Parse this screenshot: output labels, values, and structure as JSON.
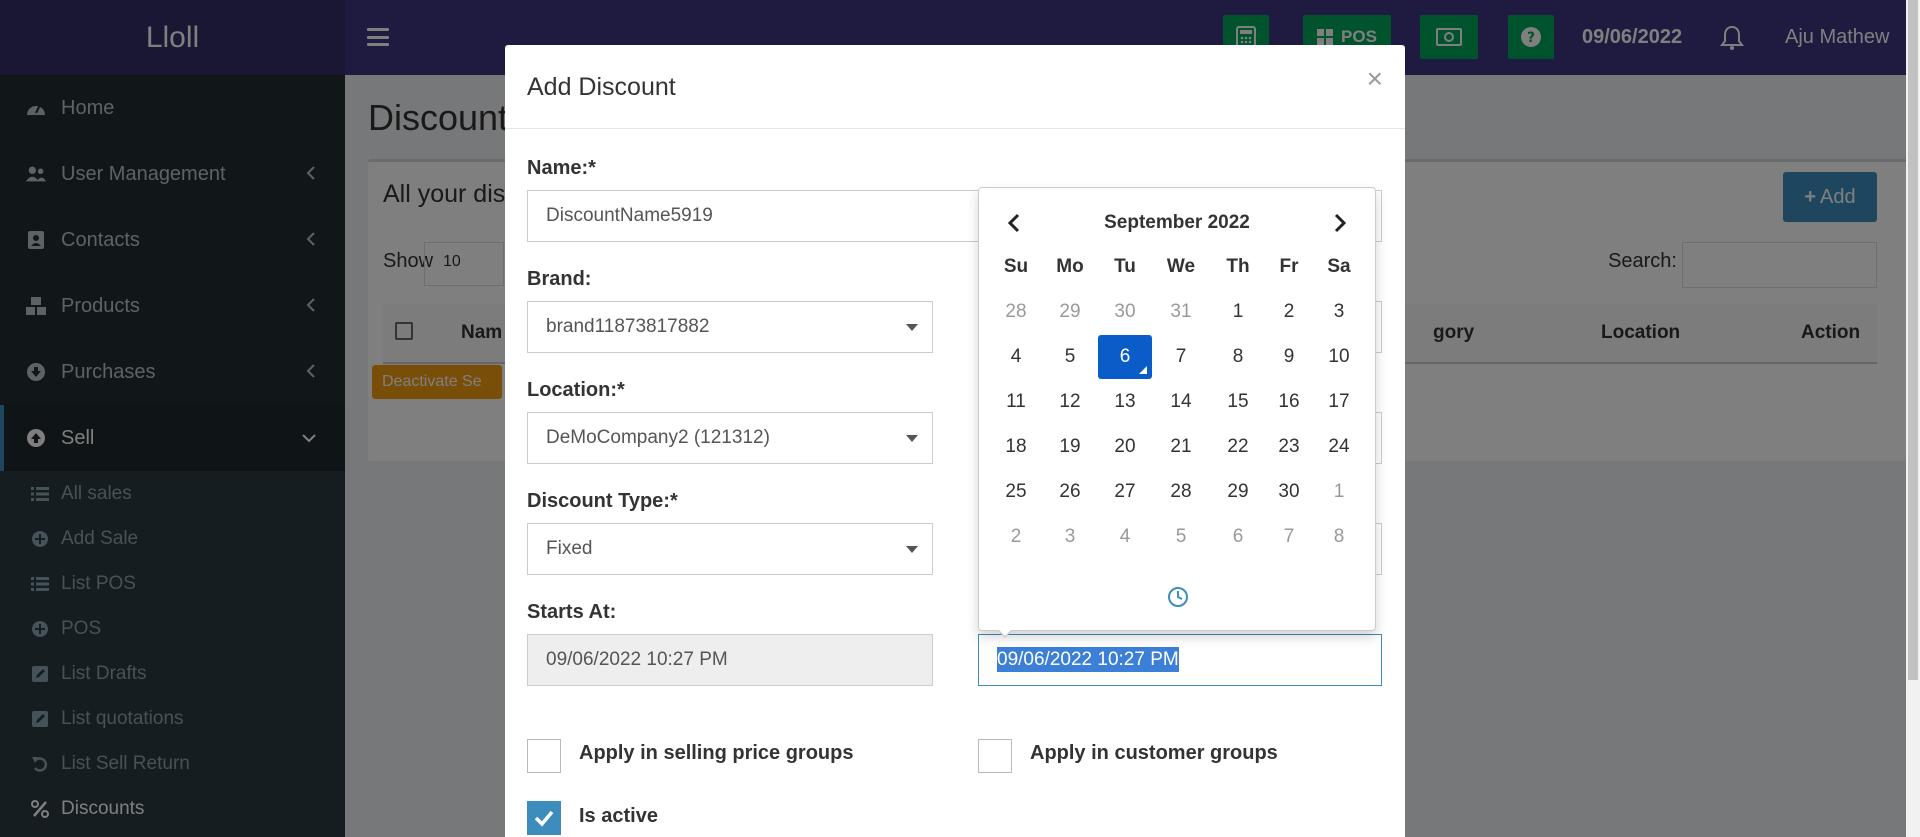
{
  "app": {
    "logo": "Lloll"
  },
  "topbar": {
    "pos_label": "POS",
    "date": "09/06/2022",
    "user": "Aju Mathew"
  },
  "sidebar": {
    "items": [
      {
        "label": "Home",
        "icon": "dashboard-icon"
      },
      {
        "label": "User Management",
        "icon": "users-icon"
      },
      {
        "label": "Contacts",
        "icon": "address-book-icon"
      },
      {
        "label": "Products",
        "icon": "cubes-icon"
      },
      {
        "label": "Purchases",
        "icon": "arrow-circle-down-icon"
      },
      {
        "label": "Sell",
        "icon": "arrow-circle-up-icon"
      }
    ],
    "sub_items": [
      {
        "label": "All sales",
        "icon": "list-icon"
      },
      {
        "label": "Add Sale",
        "icon": "plus-circle-icon"
      },
      {
        "label": "List POS",
        "icon": "list-icon"
      },
      {
        "label": "POS",
        "icon": "plus-circle-icon"
      },
      {
        "label": "List Drafts",
        "icon": "edit-icon"
      },
      {
        "label": "List quotations",
        "icon": "edit-icon"
      },
      {
        "label": "List Sell Return",
        "icon": "undo-icon"
      },
      {
        "label": "Discounts",
        "icon": "percent-icon"
      }
    ]
  },
  "page": {
    "title": "Discount",
    "box_title": "All your dis",
    "add_label": "Add",
    "show_label": "Show",
    "show_value": "10",
    "search_label": "Search:",
    "columns": [
      "Nam",
      "gory",
      "Location",
      "Action"
    ],
    "deactivate_label": "Deactivate Se"
  },
  "modal": {
    "title": "Add Discount",
    "close": "×",
    "name_label": "Name:*",
    "name_value": "DiscountName5919",
    "brand_label": "Brand:",
    "brand_value": "brand11873817882",
    "location_label": "Location:*",
    "location_value": "DeMoCompany2 (121312)",
    "discount_type_label": "Discount Type:*",
    "discount_type_value": "Fixed",
    "starts_at_label": "Starts At:",
    "starts_at_value": "09/06/2022 10:27 PM",
    "ends_at_value": "09/06/2022 10:27 PM",
    "apply_selling_label": "Apply in selling price groups",
    "apply_customer_label": "Apply in customer groups",
    "is_active_label": "Is active"
  },
  "datepicker": {
    "month": "September 2022",
    "dow": [
      "Su",
      "Mo",
      "Tu",
      "We",
      "Th",
      "Fr",
      "Sa"
    ],
    "weeks": [
      [
        "28",
        "29",
        "30",
        "31",
        "1",
        "2",
        "3"
      ],
      [
        "4",
        "5",
        "6",
        "7",
        "8",
        "9",
        "10"
      ],
      [
        "11",
        "12",
        "13",
        "14",
        "15",
        "16",
        "17"
      ],
      [
        "18",
        "19",
        "20",
        "21",
        "22",
        "23",
        "24"
      ],
      [
        "25",
        "26",
        "27",
        "28",
        "29",
        "30",
        "1"
      ],
      [
        "2",
        "3",
        "4",
        "5",
        "6",
        "7",
        "8"
      ]
    ],
    "selected": "6"
  },
  "colors": {
    "header": "#3d3580",
    "sidebar": "#222d32",
    "accent": "#3c8dbc",
    "green": "#00a65a",
    "selected_day": "#0a5cc9"
  }
}
